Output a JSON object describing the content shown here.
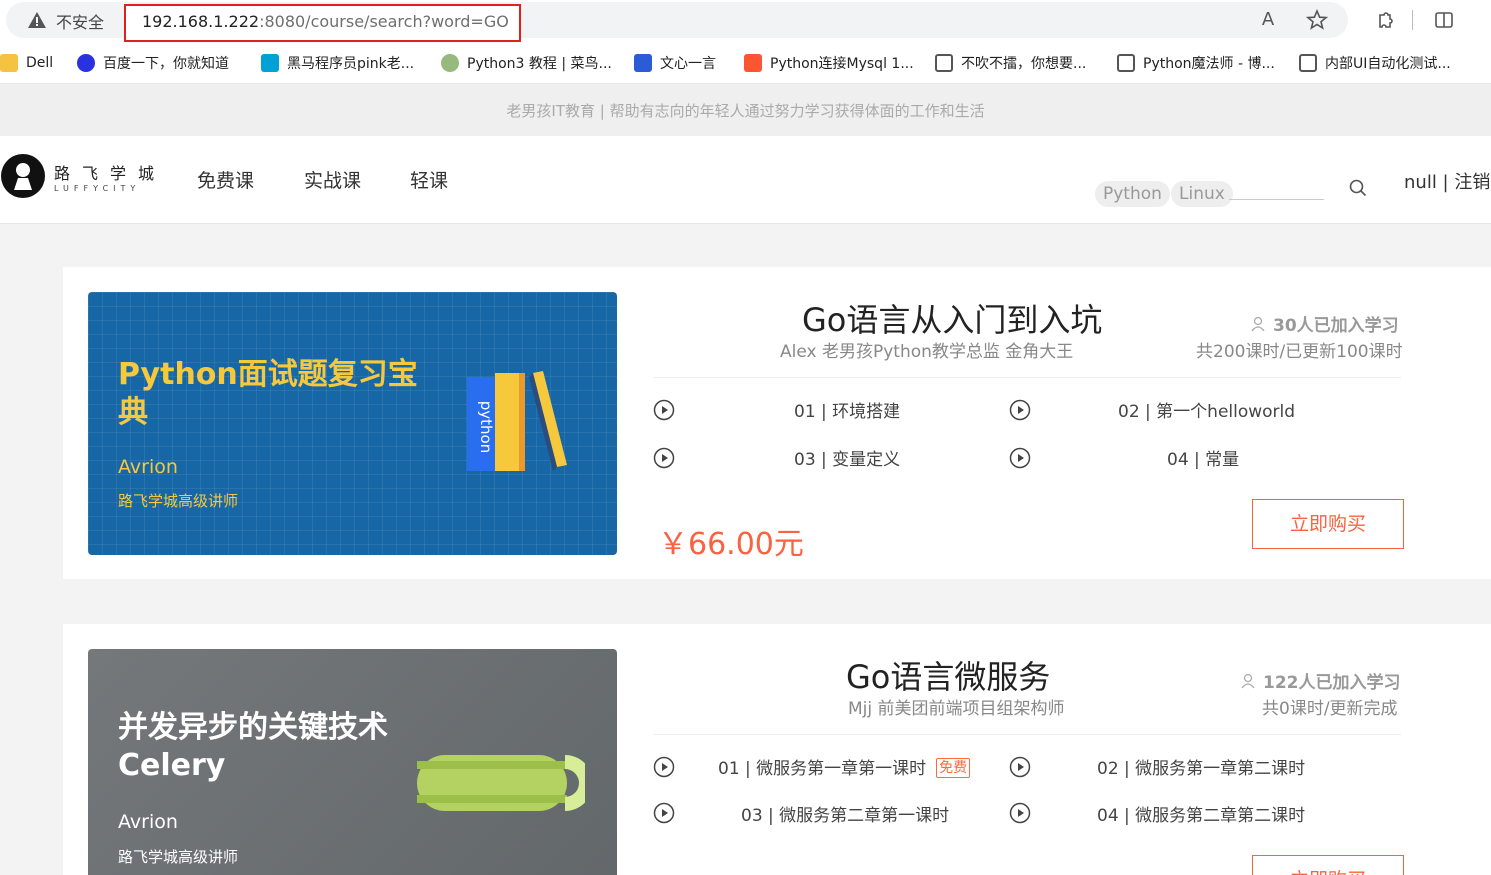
{
  "browser": {
    "insecure_label": "不安全",
    "url_host": "192.168.1.222",
    "url_rest": ":8080/course/search?word=GO",
    "bookmarks": [
      {
        "label": "Dell",
        "icon": "folder-icon",
        "color": "#f5c242"
      },
      {
        "label": "百度一下，你就知道",
        "icon": "baidu-paw-icon",
        "color": "#2932e1"
      },
      {
        "label": "黑马程序员pink老...",
        "icon": "bilibili-tv-icon",
        "color": "#00a1d6"
      },
      {
        "label": "Python3 教程 | 菜鸟...",
        "icon": "runoob-icon",
        "color": "#96b97d"
      },
      {
        "label": "文心一言",
        "icon": "wenxin-cube-icon",
        "color": "#2b5bd7"
      },
      {
        "label": "Python连接Mysql 1...",
        "icon": "csdn-c-icon",
        "color": "#fc5531"
      },
      {
        "label": "不吹不擂，你想要...",
        "icon": "cnblogs-icon",
        "color": "#555555"
      },
      {
        "label": "Python魔法师 - 博...",
        "icon": "cnblogs-icon",
        "color": "#555555"
      },
      {
        "label": "内部UI自动化测试...",
        "icon": "cnblogs-icon",
        "color": "#555555"
      }
    ]
  },
  "site": {
    "banner": "老男孩IT教育 | 帮助有志向的年轻人通过努力学习获得体面的工作和生活",
    "logo_cn": "路飞学城",
    "logo_en": "LUFFYCITY",
    "nav": [
      "免费课",
      "实战课",
      "轻课"
    ],
    "search_tags": [
      "Python",
      "Linux"
    ],
    "user_text": "null  |  注销"
  },
  "courses": [
    {
      "image_title": "Python面试题复习宝典",
      "image_author": "Avrion",
      "image_sub": "路飞学城高级讲师",
      "title": "Go语言从入门到入坑",
      "teacher": "Alex 老男孩Python教学总监 金角大王",
      "learners": "30人已加入学习",
      "hours": "共200课时/已更新100课时",
      "lessons": [
        "01 | 环境搭建",
        "02 | 第一个helloworld",
        "03 | 变量定义",
        "04 | 常量"
      ],
      "price": "￥66.00元",
      "buy_label": "立即购买"
    },
    {
      "image_title": "并发异步的关键技术 Celery",
      "image_author": "Avrion",
      "image_sub": "路飞学城高级讲师",
      "title": "Go语言微服务",
      "teacher": "Mjj 前美团前端项目组架构师",
      "learners": "122人已加入学习",
      "hours": "共0课时/更新完成",
      "lessons": [
        "01 | 微服务第一章第一课时",
        "02 | 微服务第一章第二课时",
        "03 | 微服务第二章第一课时",
        "04 | 微服务第二章第二课时"
      ],
      "free_badge": "免费",
      "buy_label": "立即购买"
    }
  ]
}
